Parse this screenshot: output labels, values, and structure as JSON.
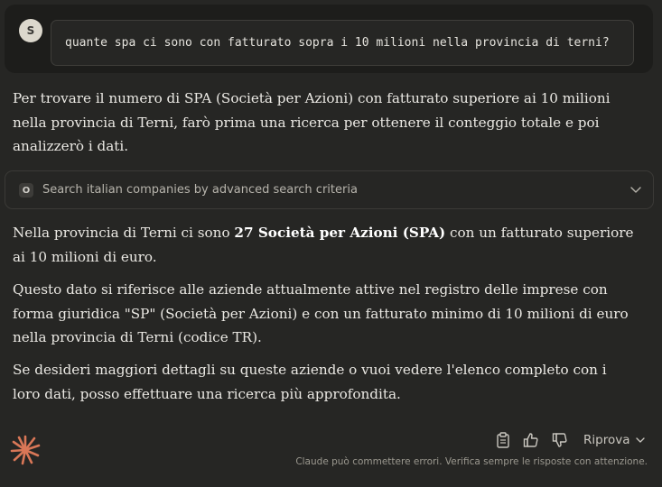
{
  "user": {
    "avatar_initial": "S",
    "message": "quante spa ci sono con fatturato sopra i 10 milioni nella provincia di terni?"
  },
  "assistant": {
    "intro": "Per trovare il numero di SPA (Società per Azioni) con fatturato superiore ai 10 milioni nella provincia di Terni, farò prima una ricerca per ottenere il conteggio totale e poi analizzerò i dati.",
    "tool_call": {
      "icon_letter": "O",
      "label": "Search italian companies by advanced search criteria"
    },
    "answer_pre": "Nella provincia di Terni ci sono ",
    "answer_bold": "27 Società per Azioni (SPA)",
    "answer_post": " con un fatturato superiore ai 10 milioni di euro.",
    "para2": "Questo dato si riferisce alle aziende attualmente attive nel registro delle imprese con forma giuridica \"SP\" (Società per Azioni) e con un fatturato minimo di 10 milioni di euro nella provincia di Terni (codice TR).",
    "para3": "Se desideri maggiori dettagli su queste aziende o vuoi vedere l'elenco completo con i loro dati, posso effettuare una ricerca più approfondita."
  },
  "actions": {
    "icons": [
      "clipboard-icon",
      "thumbs-up-icon",
      "thumbs-down-icon"
    ],
    "retry_label": "Riprova"
  },
  "disclaimer": "Claude può commettere errori. Verifica sempre le risposte con attenzione.",
  "colors": {
    "background": "#262624",
    "user_block": "#1d1d1b",
    "accent": "#d97757"
  }
}
